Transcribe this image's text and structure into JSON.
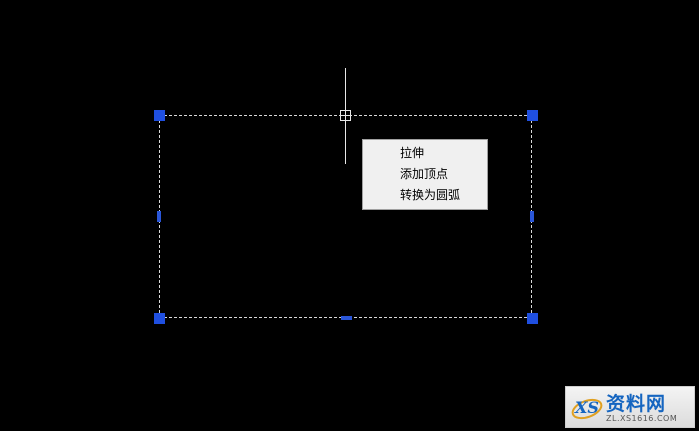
{
  "context_menu": {
    "items": [
      {
        "label": "拉伸"
      },
      {
        "label": "添加顶点"
      },
      {
        "label": "转换为圆弧"
      }
    ]
  },
  "watermark": {
    "title": "资料网",
    "url": "ZL.XS1616.COM"
  },
  "colors": {
    "background": "#000000",
    "grip": "#1f4fe0",
    "selection_dash": "#d8d8d8",
    "menu_bg": "#f0f0f0"
  }
}
